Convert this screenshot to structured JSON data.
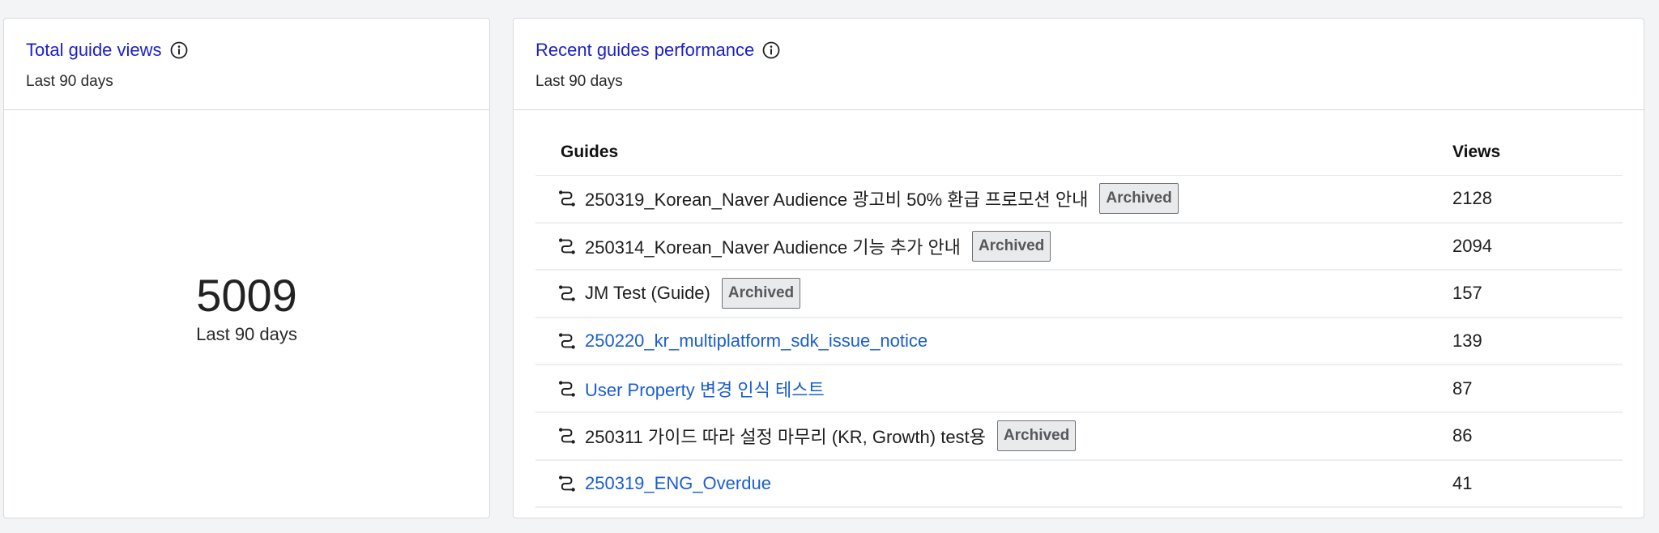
{
  "total_views_card": {
    "title": "Total guide views",
    "subtitle": "Last 90 days",
    "value": "5009",
    "caption": "Last 90 days",
    "info_icon": "info-circle-icon"
  },
  "recent_card": {
    "title": "Recent guides performance",
    "subtitle": "Last 90 days",
    "info_icon": "info-circle-icon",
    "columns": {
      "guides": "Guides",
      "views": "Views"
    },
    "rows": [
      {
        "name": "250319_Korean_Naver Audience 광고비 50% 환급 프로모션 안내",
        "badge": "Archived",
        "views": "2128",
        "link": false
      },
      {
        "name": "250314_Korean_Naver Audience 기능 추가 안내",
        "badge": "Archived",
        "views": "2094",
        "link": false
      },
      {
        "name": "JM Test (Guide)",
        "badge": "Archived",
        "views": "157",
        "link": false
      },
      {
        "name": "250220_kr_multiplatform_sdk_issue_notice",
        "badge": "",
        "views": "139",
        "link": true
      },
      {
        "name": "User Property 변경 인식 테스트",
        "badge": "",
        "views": "87",
        "link": true
      },
      {
        "name": "250311 가이드 따라 설정 마무리 (KR, Growth) test용",
        "badge": "Archived",
        "views": "86",
        "link": false
      },
      {
        "name": "250319_ENG_Overdue",
        "badge": "",
        "views": "41",
        "link": true
      }
    ]
  },
  "colors": {
    "title": "#1b1fc9",
    "link": "#1a5ed1",
    "badge_bg": "#e9eaec",
    "page_bg": "#f3f4f6"
  },
  "row_icon": "guide-flow-icon"
}
